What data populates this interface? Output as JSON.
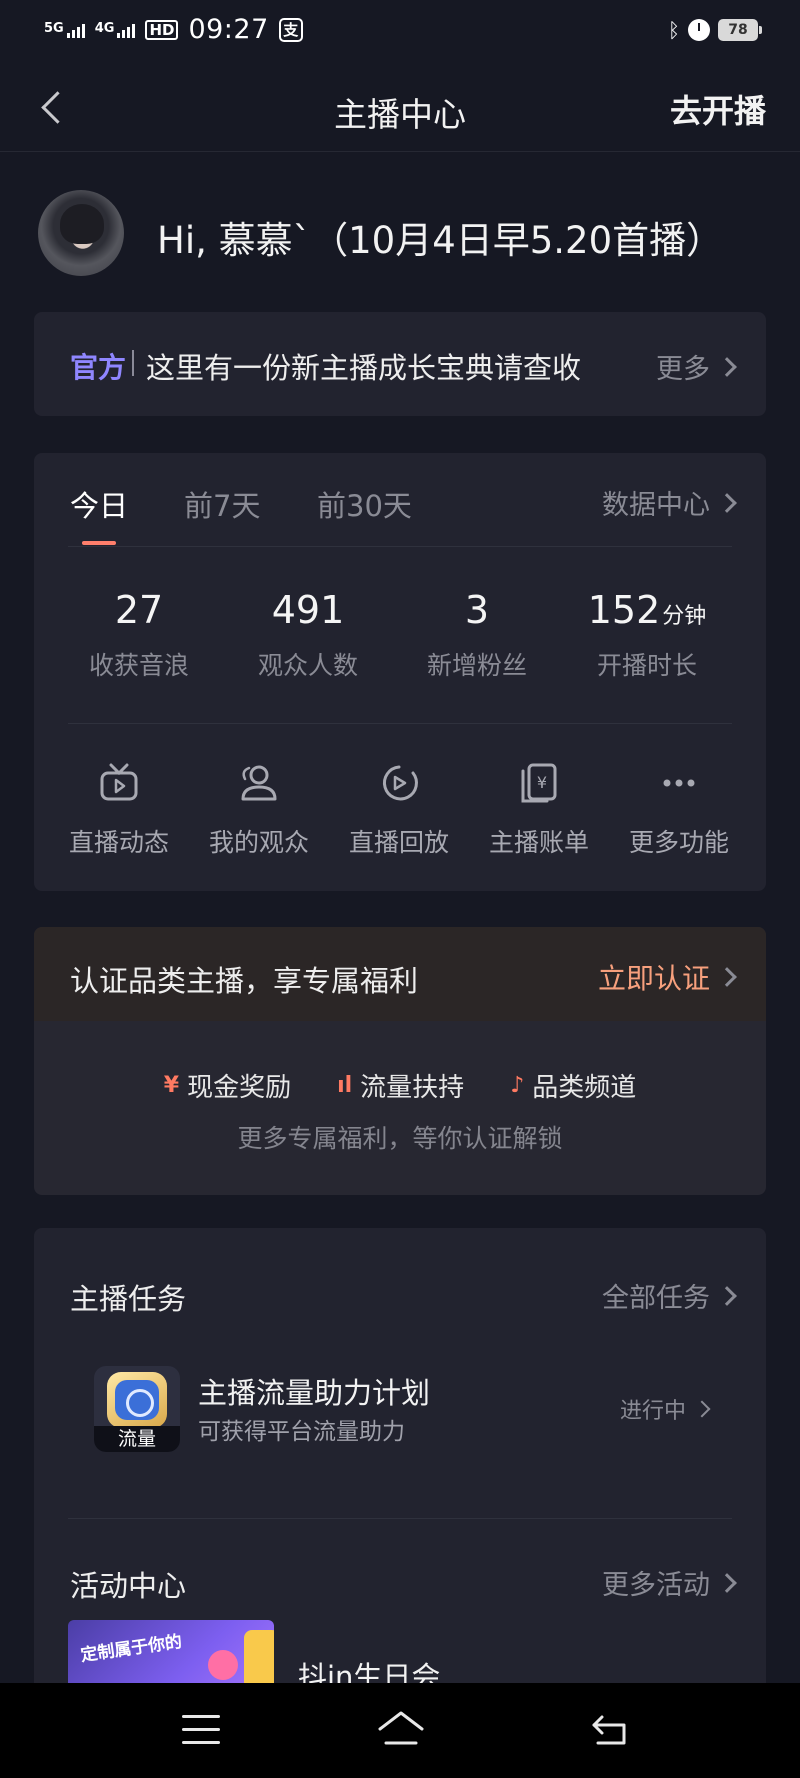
{
  "status_bar": {
    "signal1": "5G",
    "signal2": "4G",
    "hd": "HD",
    "time": "09:27",
    "app_badge": "支",
    "battery": "78"
  },
  "nav": {
    "title": "主播中心",
    "action": "去开播"
  },
  "greeting": "Hi, 慕慕`（10月4日早5.20首播）",
  "official": {
    "tag": "官方",
    "text": "这里有一份新主播成长宝典请查收",
    "more": "更多"
  },
  "stats": {
    "tabs": [
      {
        "label": "今日"
      },
      {
        "label": "前7天"
      },
      {
        "label": "前30天"
      }
    ],
    "data_center": "数据中心",
    "metrics": [
      {
        "value": "27",
        "unit": "",
        "label": "收获音浪"
      },
      {
        "value": "491",
        "unit": "",
        "label": "观众人数"
      },
      {
        "value": "3",
        "unit": "",
        "label": "新增粉丝"
      },
      {
        "value": "152",
        "unit": "分钟",
        "label": "开播时长"
      }
    ],
    "functions": [
      {
        "label": "直播动态",
        "icon": "tv-icon"
      },
      {
        "label": "我的观众",
        "icon": "audience-icon"
      },
      {
        "label": "直播回放",
        "icon": "replay-icon"
      },
      {
        "label": "主播账单",
        "icon": "bill-icon"
      },
      {
        "label": "更多功能",
        "icon": "more-dots-icon"
      }
    ]
  },
  "certify": {
    "title": "认证品类主播，享专属福利",
    "button": "立即认证",
    "benefits": [
      {
        "icon": "¥",
        "label": "现金奖励"
      },
      {
        "icon": "ıl",
        "label": "流量扶持"
      },
      {
        "icon": "♪",
        "label": "品类频道"
      }
    ],
    "subtitle": "更多专属福利，等你认证解锁"
  },
  "tasks": {
    "title": "主播任务",
    "all_link": "全部任务",
    "task": {
      "icon_caption": "流量",
      "name": "主播流量助力计划",
      "desc": "可获得平台流量助力",
      "status": "进行中"
    },
    "activity_title": "活动中心",
    "activity_link": "更多活动",
    "banner_text": "定制属于你的",
    "activity_name": "抖in生日会"
  },
  "colors": {
    "background": "#161823",
    "card": "#22232f",
    "accent_tab": "#ff7f6c",
    "official_tag": "#8f86ff",
    "certify_button": "#f7a07d"
  }
}
